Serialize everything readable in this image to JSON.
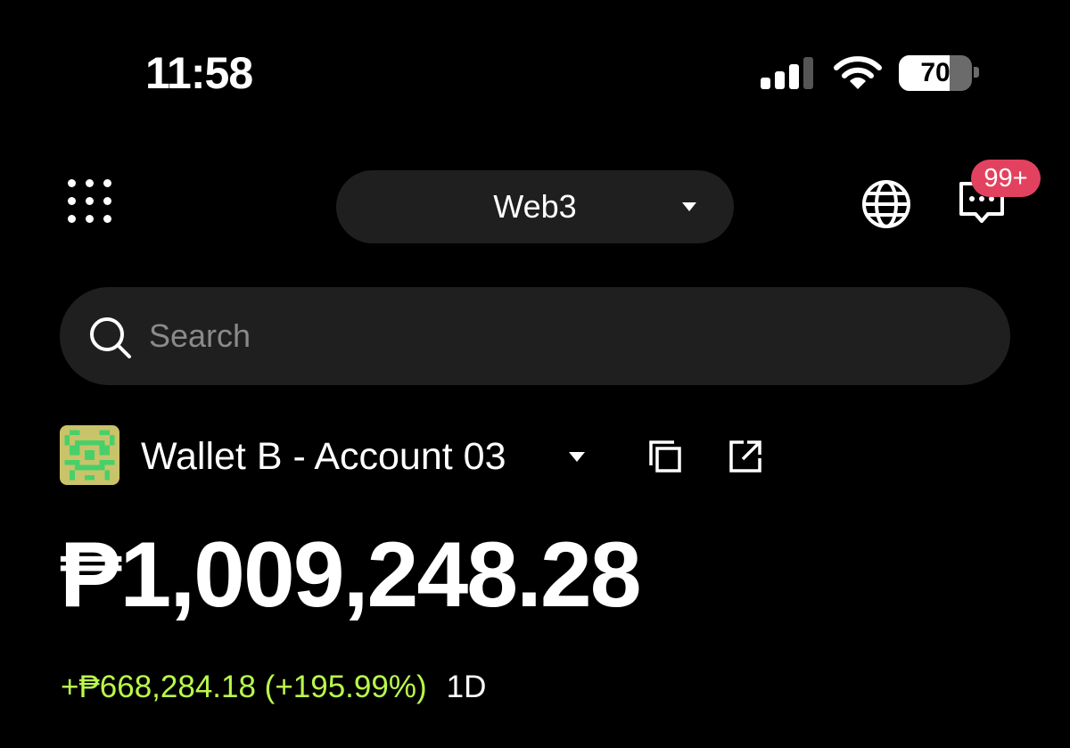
{
  "status_bar": {
    "time": "11:58",
    "battery_level": "70",
    "battery_fraction": 0.7,
    "signal_bars_active": 3,
    "signal_bars_total": 4
  },
  "header": {
    "mode_selector_label": "Web3",
    "notification_badge": "99+"
  },
  "search": {
    "placeholder": "Search"
  },
  "account": {
    "name": "Wallet B - Account 03",
    "balance": "₱1,009,248.28",
    "change": "+₱668,284.18 (+195.99%)",
    "period": "1D"
  },
  "colors": {
    "background": "#000000",
    "surface": "#1f1f1f",
    "positive_change": "#b9f94b",
    "badge": "#e2425f",
    "avatar_base": "#c9c36a",
    "avatar_pattern": "#47d06a"
  },
  "icons": {
    "apps": "grid-dots-icon",
    "globe": "globe-icon",
    "messages": "message-bubble-icon",
    "search": "search-icon",
    "copy": "copy-icon",
    "external_link": "external-link-icon"
  }
}
